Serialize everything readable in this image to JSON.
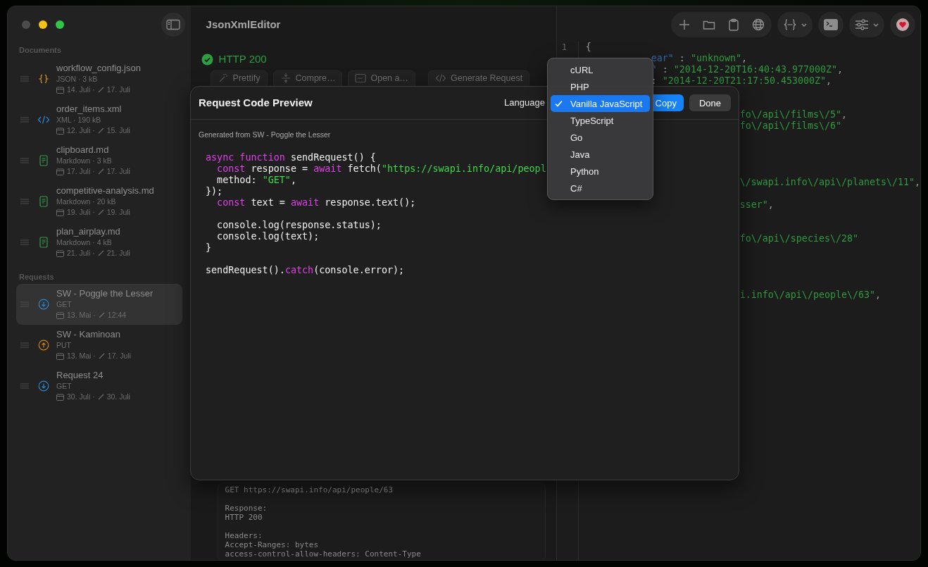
{
  "window": {
    "title": "JsonXmlEditor"
  },
  "sidebar": {
    "sections": [
      {
        "title": "Documents",
        "items": [
          {
            "name": "workflow_config.json",
            "kind": "json",
            "meta": "JSON · 3 kB",
            "created": "14. Juli ·",
            "modified": "17. Juli",
            "selected": false
          },
          {
            "name": "order_items.xml",
            "kind": "xml",
            "meta": "XML · 190 kB",
            "created": "12. Juli ·",
            "modified": "15. Juli",
            "selected": false
          },
          {
            "name": "clipboard.md",
            "kind": "markdown",
            "meta": "Markdown · 3 kB",
            "created": "17. Juli ·",
            "modified": "17. Juli",
            "selected": false
          },
          {
            "name": "competitive-analysis.md",
            "kind": "markdown",
            "meta": "Markdown · 20 kB",
            "created": "19. Juli ·",
            "modified": "19. Juli",
            "selected": false
          },
          {
            "name": "plan_airplay.md",
            "kind": "markdown",
            "meta": "Markdown · 4 kB",
            "created": "21. Juli ·",
            "modified": "21. Juli",
            "selected": false
          }
        ]
      },
      {
        "title": "Requests",
        "items": [
          {
            "name": "SW - Poggle the Lesser",
            "kind": "download",
            "meta": "GET",
            "created": "13. Mai ·",
            "modified": "12:44",
            "selected": true
          },
          {
            "name": "SW - Kaminoan",
            "kind": "upload",
            "meta": "PUT",
            "created": "13. Mai ·",
            "modified": "17. Juli",
            "selected": false
          },
          {
            "name": "Request 24",
            "kind": "download",
            "meta": "GET",
            "created": "30. Juli ·",
            "modified": "30. Juli",
            "selected": false
          }
        ]
      }
    ]
  },
  "status": {
    "text": "HTTP 200",
    "ok": true
  },
  "actions": [
    {
      "label": "Prettify",
      "kind": "prettify"
    },
    {
      "label": "Compre…",
      "kind": "compress"
    },
    {
      "label": "Open a…",
      "kind": "open"
    },
    {
      "label": "Generate Request",
      "kind": "code"
    }
  ],
  "output": {
    "paragraphs": [
      [
        "GET https://swapi.info/api/people/63"
      ],
      [
        "Response:",
        "HTTP 200"
      ],
      [
        "Headers:",
        "Accept-Ranges: bytes",
        "access-control-allow-headers: Content-Type"
      ]
    ]
  },
  "editor": {
    "line_number": "1",
    "lines": [
      [
        {
          "kind": "plain",
          "text": "{"
        }
      ],
      [
        {
          "kind": "key",
          "text": "ear\""
        },
        {
          "kind": "plain",
          "text": " : "
        },
        {
          "kind": "string",
          "text": "\"unknown\""
        },
        {
          "kind": "plain",
          "text": ","
        }
      ],
      [
        {
          "kind": "key",
          "text": "\""
        },
        {
          "kind": "plain",
          "text": " : "
        },
        {
          "kind": "string",
          "text": "\"2014-12-20T16:40:43.977000Z\""
        },
        {
          "kind": "plain",
          "text": ","
        }
      ],
      [
        {
          "kind": "plain",
          "text": ": "
        },
        {
          "kind": "string",
          "text": "\"2014-12-20T21:17:50.453000Z\""
        },
        {
          "kind": "plain",
          "text": ","
        }
      ],
      [
        {
          "kind": "string",
          "text": "fo\\/api\\/films\\/5\""
        },
        {
          "kind": "plain",
          "text": ","
        }
      ],
      [
        {
          "kind": "string",
          "text": "fo\\/api\\/films\\/6\""
        }
      ],
      [
        {
          "kind": "string",
          "text": "\\/swapi.info\\/api\\/planets\\/11\""
        },
        {
          "kind": "plain",
          "text": ","
        }
      ],
      [
        {
          "kind": "string",
          "text": "sser\""
        },
        {
          "kind": "plain",
          "text": ","
        }
      ],
      [
        {
          "kind": "string",
          "text": "fo\\/api\\/species\\/28\""
        }
      ],
      [
        {
          "kind": "string",
          "text": "i.info\\/api\\/people\\/63\""
        },
        {
          "kind": "plain",
          "text": ","
        }
      ]
    ]
  },
  "sheet": {
    "title": "Request Code Preview",
    "language_label": "Language",
    "copy": "Copy",
    "done": "Done",
    "source": "Generated from SW - Poggle the Lesser",
    "code_blocks": [
      [
        [
          {
            "kind": "keyword",
            "text": "async function"
          },
          {
            "kind": "plain",
            "text": " sendRequest() {"
          }
        ],
        [
          {
            "kind": "keyword",
            "text": "  const"
          },
          {
            "kind": "plain",
            "text": " response = "
          },
          {
            "kind": "keyword",
            "text": "await"
          },
          {
            "kind": "plain",
            "text": " fetch("
          },
          {
            "kind": "string",
            "text": "\"https://swapi.info/api/peopl"
          }
        ],
        [
          {
            "kind": "plain",
            "text": "  method: "
          },
          {
            "kind": "string",
            "text": "\"GET\""
          },
          {
            "kind": "plain",
            "text": ","
          }
        ],
        [
          {
            "kind": "plain",
            "text": "});"
          }
        ],
        [
          {
            "kind": "keyword",
            "text": "  const"
          },
          {
            "kind": "plain",
            "text": " text = "
          },
          {
            "kind": "keyword",
            "text": "await"
          },
          {
            "kind": "plain",
            "text": " response.text();"
          }
        ]
      ],
      [
        [
          {
            "kind": "plain",
            "text": "  console.log(response.status);"
          }
        ],
        [
          {
            "kind": "plain",
            "text": "  console.log(text);"
          }
        ],
        [
          {
            "kind": "plain",
            "text": "}"
          }
        ]
      ],
      [
        [
          {
            "kind": "plain",
            "text": "sendRequest()."
          },
          {
            "kind": "keyword",
            "text": "catch"
          },
          {
            "kind": "plain",
            "text": "(console.error);"
          }
        ]
      ]
    ]
  },
  "language_menu": {
    "items": [
      {
        "label": "cURL",
        "selected": false
      },
      {
        "label": "PHP",
        "selected": false
      },
      {
        "label": "Vanilla JavaScript",
        "selected": true
      },
      {
        "label": "TypeScript",
        "selected": false
      },
      {
        "label": "Go",
        "selected": false
      },
      {
        "label": "Java",
        "selected": false
      },
      {
        "label": "Python",
        "selected": false
      },
      {
        "label": "C#",
        "selected": false
      }
    ]
  }
}
